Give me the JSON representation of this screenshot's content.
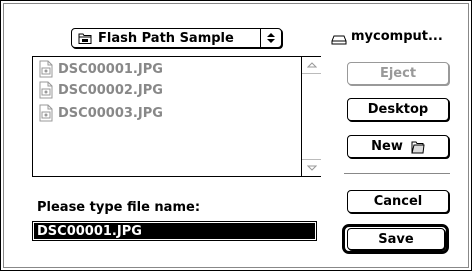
{
  "folder_popup": {
    "label": "Flash Path Sample",
    "icon": "folder-icon"
  },
  "volume": {
    "label": "mycomput...",
    "icon": "disk-icon"
  },
  "file_list": {
    "items": [
      {
        "name": "DSC00001.JPG",
        "icon": "file-icon"
      },
      {
        "name": "DSC00002.JPG",
        "icon": "file-icon"
      },
      {
        "name": "DSC00003.JPG",
        "icon": "file-icon"
      }
    ]
  },
  "buttons": {
    "eject": "Eject",
    "desktop": "Desktop",
    "new": "New",
    "cancel": "Cancel",
    "save": "Save"
  },
  "prompt": "Please type file name:",
  "filename_value": "DSC00001.JPG"
}
